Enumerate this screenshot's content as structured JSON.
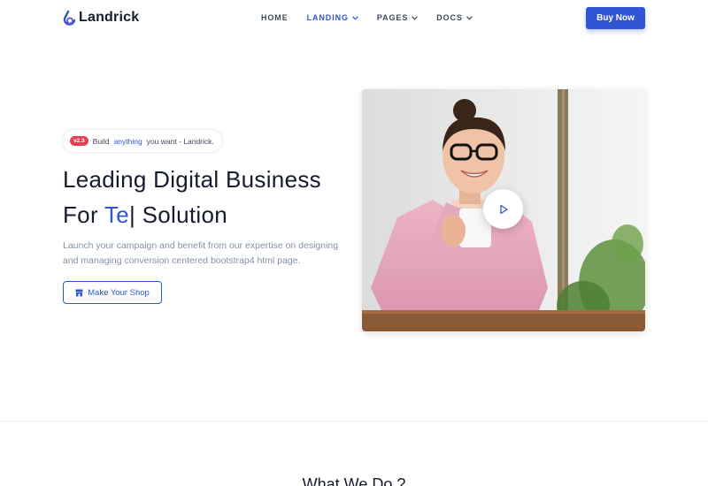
{
  "brand": {
    "name": "Landrick",
    "logo_icon": "landrick-logo-icon"
  },
  "nav": {
    "items": [
      {
        "label": "HOME",
        "dropdown": false,
        "active": false
      },
      {
        "label": "LANDING",
        "dropdown": true,
        "active": true
      },
      {
        "label": "PAGES",
        "dropdown": true,
        "active": false
      },
      {
        "label": "DOCS",
        "dropdown": true,
        "active": false
      }
    ],
    "cta_label": "Buy Now"
  },
  "hero": {
    "badge": {
      "version": "v2.3",
      "text_before": "Build",
      "highlight": "anything",
      "text_after": "you want - Landrick."
    },
    "title_line1": "Leading Digital Business",
    "title_prefix": "For",
    "title_typed": "Te",
    "title_caret": "|",
    "title_suffix": "Solution",
    "description": "Launch your campaign and benefit from our expertise on designing and managing conversion centered bootstrap4 html page.",
    "button_label": "Make Your Shop",
    "button_icon": "store-icon",
    "image_alt": "woman holding coffee mug",
    "play_icon": "play-icon"
  },
  "next_section": {
    "title": "What We Do ?"
  },
  "colors": {
    "primary": "#2f55d4",
    "danger": "#e43f52",
    "heading": "#161c2d",
    "muted": "#8492a6"
  }
}
